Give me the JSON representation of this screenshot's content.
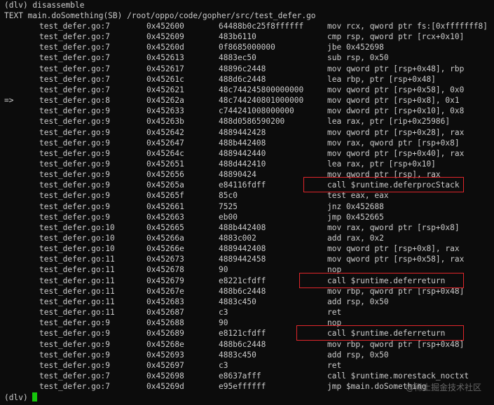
{
  "terminal": {
    "command_line": "(dlv) disassemble",
    "header": "TEXT main.doSomething(SB) /root/oppo/code/gopher/src/test_defer.go",
    "prompt": "(dlv)",
    "current_line_marker": "=>",
    "cursor_color": "#16c60c",
    "highlight_color": "#e0262b",
    "rows": [
      {
        "marker": "",
        "loc": "test_defer.go:7",
        "addr": "0x452600",
        "bytes": "64488b0c25f8ffffff",
        "asm": "mov rcx, qword ptr fs:[0xfffffff8]"
      },
      {
        "marker": "",
        "loc": "test_defer.go:7",
        "addr": "0x452609",
        "bytes": "483b6110",
        "asm": "cmp rsp, qword ptr [rcx+0x10]"
      },
      {
        "marker": "",
        "loc": "test_defer.go:7",
        "addr": "0x45260d",
        "bytes": "0f8685000000",
        "asm": "jbe 0x452698"
      },
      {
        "marker": "",
        "loc": "test_defer.go:7",
        "addr": "0x452613",
        "bytes": "4883ec50",
        "asm": "sub rsp, 0x50"
      },
      {
        "marker": "",
        "loc": "test_defer.go:7",
        "addr": "0x452617",
        "bytes": "48896c2448",
        "asm": "mov qword ptr [rsp+0x48], rbp"
      },
      {
        "marker": "",
        "loc": "test_defer.go:7",
        "addr": "0x45261c",
        "bytes": "488d6c2448",
        "asm": "lea rbp, ptr [rsp+0x48]"
      },
      {
        "marker": "",
        "loc": "test_defer.go:7",
        "addr": "0x452621",
        "bytes": "48c744245800000000",
        "asm": "mov qword ptr [rsp+0x58], 0x0"
      },
      {
        "marker": "=>",
        "loc": "test_defer.go:8",
        "addr": "0x45262a",
        "bytes": "48c744240801000000",
        "asm": "mov qword ptr [rsp+0x8], 0x1"
      },
      {
        "marker": "",
        "loc": "test_defer.go:9",
        "addr": "0x452633",
        "bytes": "c744241008000000",
        "asm": "mov dword ptr [rsp+0x10], 0x8"
      },
      {
        "marker": "",
        "loc": "test_defer.go:9",
        "addr": "0x45263b",
        "bytes": "488d0586590200",
        "asm": "lea rax, ptr [rip+0x25986]"
      },
      {
        "marker": "",
        "loc": "test_defer.go:9",
        "addr": "0x452642",
        "bytes": "4889442428",
        "asm": "mov qword ptr [rsp+0x28], rax"
      },
      {
        "marker": "",
        "loc": "test_defer.go:9",
        "addr": "0x452647",
        "bytes": "488b442408",
        "asm": "mov rax, qword ptr [rsp+0x8]"
      },
      {
        "marker": "",
        "loc": "test_defer.go:9",
        "addr": "0x45264c",
        "bytes": "4889442440",
        "asm": "mov qword ptr [rsp+0x40], rax"
      },
      {
        "marker": "",
        "loc": "test_defer.go:9",
        "addr": "0x452651",
        "bytes": "488d442410",
        "asm": "lea rax, ptr [rsp+0x10]"
      },
      {
        "marker": "",
        "loc": "test_defer.go:9",
        "addr": "0x452656",
        "bytes": "48890424",
        "asm": "mov qword ptr [rsp], rax"
      },
      {
        "marker": "",
        "loc": "test_defer.go:9",
        "addr": "0x45265a",
        "bytes": "e84116fdff",
        "asm": "call $runtime.deferprocStack"
      },
      {
        "marker": "",
        "loc": "test_defer.go:9",
        "addr": "0x45265f",
        "bytes": "85c0",
        "asm": "test eax, eax"
      },
      {
        "marker": "",
        "loc": "test_defer.go:9",
        "addr": "0x452661",
        "bytes": "7525",
        "asm": "jnz 0x452688"
      },
      {
        "marker": "",
        "loc": "test_defer.go:9",
        "addr": "0x452663",
        "bytes": "eb00",
        "asm": "jmp 0x452665"
      },
      {
        "marker": "",
        "loc": "test_defer.go:10",
        "addr": "0x452665",
        "bytes": "488b442408",
        "asm": "mov rax, qword ptr [rsp+0x8]"
      },
      {
        "marker": "",
        "loc": "test_defer.go:10",
        "addr": "0x45266a",
        "bytes": "4883c002",
        "asm": "add rax, 0x2"
      },
      {
        "marker": "",
        "loc": "test_defer.go:10",
        "addr": "0x45266e",
        "bytes": "4889442408",
        "asm": "mov qword ptr [rsp+0x8], rax"
      },
      {
        "marker": "",
        "loc": "test_defer.go:11",
        "addr": "0x452673",
        "bytes": "4889442458",
        "asm": "mov qword ptr [rsp+0x58], rax"
      },
      {
        "marker": "",
        "loc": "test_defer.go:11",
        "addr": "0x452678",
        "bytes": "90",
        "asm": "nop"
      },
      {
        "marker": "",
        "loc": "test_defer.go:11",
        "addr": "0x452679",
        "bytes": "e8221cfdff",
        "asm": "call $runtime.deferreturn"
      },
      {
        "marker": "",
        "loc": "test_defer.go:11",
        "addr": "0x45267e",
        "bytes": "488b6c2448",
        "asm": "mov rbp, qword ptr [rsp+0x48]"
      },
      {
        "marker": "",
        "loc": "test_defer.go:11",
        "addr": "0x452683",
        "bytes": "4883c450",
        "asm": "add rsp, 0x50"
      },
      {
        "marker": "",
        "loc": "test_defer.go:11",
        "addr": "0x452687",
        "bytes": "c3",
        "asm": "ret"
      },
      {
        "marker": "",
        "loc": "test_defer.go:9",
        "addr": "0x452688",
        "bytes": "90",
        "asm": "nop"
      },
      {
        "marker": "",
        "loc": "test_defer.go:9",
        "addr": "0x452689",
        "bytes": "e8121cfdff",
        "asm": "call $runtime.deferreturn"
      },
      {
        "marker": "",
        "loc": "test_defer.go:9",
        "addr": "0x45268e",
        "bytes": "488b6c2448",
        "asm": "mov rbp, qword ptr [rsp+0x48]"
      },
      {
        "marker": "",
        "loc": "test_defer.go:9",
        "addr": "0x452693",
        "bytes": "4883c450",
        "asm": "add rsp, 0x50"
      },
      {
        "marker": "",
        "loc": "test_defer.go:9",
        "addr": "0x452697",
        "bytes": "c3",
        "asm": "ret"
      },
      {
        "marker": "",
        "loc": "test_defer.go:7",
        "addr": "0x452698",
        "bytes": "e8637afff",
        "asm": "call $runtime.morestack_noctxt"
      },
      {
        "marker": "",
        "loc": "test_defer.go:7",
        "addr": "0x45269d",
        "bytes": "e95effffff",
        "asm": "jmp $main.doSomething"
      }
    ],
    "highlighted_rows": [
      15,
      24,
      29
    ]
  },
  "watermark": "@稀土掘金技术社区"
}
